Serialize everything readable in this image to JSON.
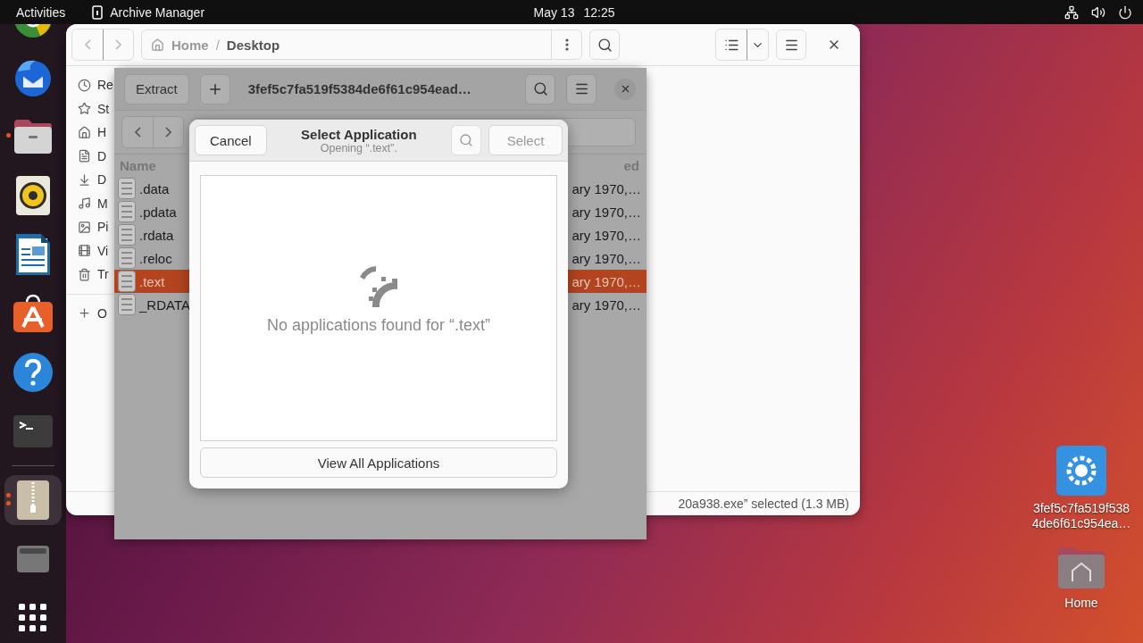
{
  "top_bar": {
    "activities": "Activities",
    "app_name": "Archive Manager",
    "date": "May 13",
    "time": "12:25"
  },
  "dock": [
    {
      "kind": "browser",
      "running": false,
      "focused": false
    },
    {
      "kind": "mail",
      "running": false,
      "focused": false
    },
    {
      "kind": "files",
      "running": true,
      "focused": false
    },
    {
      "kind": "music",
      "running": false,
      "focused": false
    },
    {
      "kind": "writer",
      "running": false,
      "focused": false
    },
    {
      "kind": "store",
      "running": false,
      "focused": false
    },
    {
      "kind": "help",
      "running": false,
      "focused": false
    },
    {
      "kind": "terminal",
      "running": false,
      "focused": false
    },
    {
      "kind": "archive",
      "running": true,
      "focused": true
    },
    {
      "kind": "drive",
      "running": false,
      "focused": false
    },
    {
      "kind": "apps",
      "running": false,
      "focused": false
    }
  ],
  "files_window": {
    "path": [
      "Home",
      "Desktop"
    ],
    "path_separator": "/",
    "sidebar": [
      {
        "kind": "recent",
        "label": "Re"
      },
      {
        "kind": "starred",
        "label": "St"
      },
      {
        "kind": "home",
        "label": "H"
      },
      {
        "kind": "documents",
        "label": "D"
      },
      {
        "kind": "downloads",
        "label": "D"
      },
      {
        "kind": "music",
        "label": "M"
      },
      {
        "kind": "pictures",
        "label": "Pi"
      },
      {
        "kind": "videos",
        "label": "Vi"
      },
      {
        "kind": "trash",
        "label": "Tr"
      },
      {
        "kind": "other",
        "label": "O"
      }
    ],
    "status": "20a938.exe” selected (1.3 MB)"
  },
  "archive_window": {
    "extract": "Extract",
    "title": "3fef5c7fa519f5384de6f61c954ead…",
    "columns": [
      "Name",
      "ed"
    ],
    "rows": [
      {
        "name": ".data",
        "date": "ary 1970,…",
        "selected": false
      },
      {
        "name": ".pdata",
        "date": "ary 1970,…",
        "selected": false
      },
      {
        "name": ".rdata",
        "date": "ary 1970,…",
        "selected": false
      },
      {
        "name": ".reloc",
        "date": "ary 1970,…",
        "selected": false
      },
      {
        "name": ".text",
        "date": "ary 1970,…",
        "selected": true
      },
      {
        "name": "_RDATA",
        "date": "ary 1970,…",
        "selected": false
      }
    ]
  },
  "dialog": {
    "cancel": "Cancel",
    "title": "Select Application",
    "subtitle": "Opening “.text”.",
    "select": {
      "label": "Select",
      "disabled": true
    },
    "empty_message": "No applications found for “.text”",
    "view_all": "View All Applications"
  },
  "desktop_icons": [
    {
      "kind": "executable",
      "label_lines": [
        "3fef5c7fa519f538",
        "4de6f61c954ea…"
      ]
    },
    {
      "kind": "home",
      "label_lines": [
        "Home"
      ]
    }
  ]
}
